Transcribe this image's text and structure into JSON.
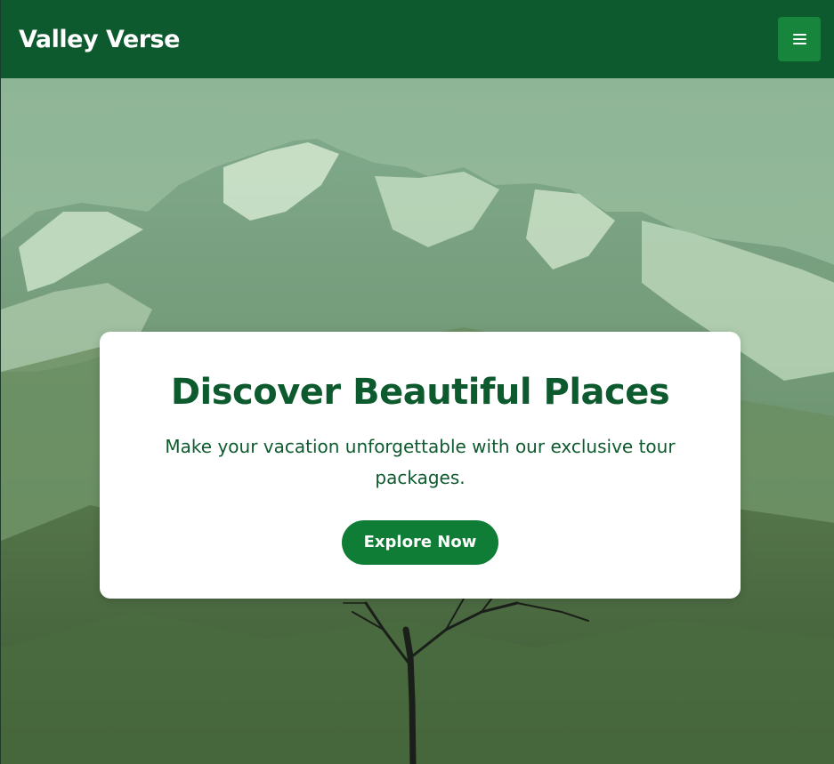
{
  "header": {
    "brand": "Valley Verse",
    "menu_icon": "hamburger-menu-icon"
  },
  "hero": {
    "background_image": "snowy mountain range with bare tree, green tint",
    "title": "Discover Beautiful Places",
    "subtitle": "Make your vacation unforgettable with our exclusive tour packages.",
    "cta_label": "Explore Now"
  },
  "colors": {
    "nav_bg": "#0e5a2f",
    "menu_button_bg": "#17853b",
    "cta_bg": "#0f7d35",
    "heading_text": "#0e5a2f",
    "card_bg": "#ffffff"
  }
}
